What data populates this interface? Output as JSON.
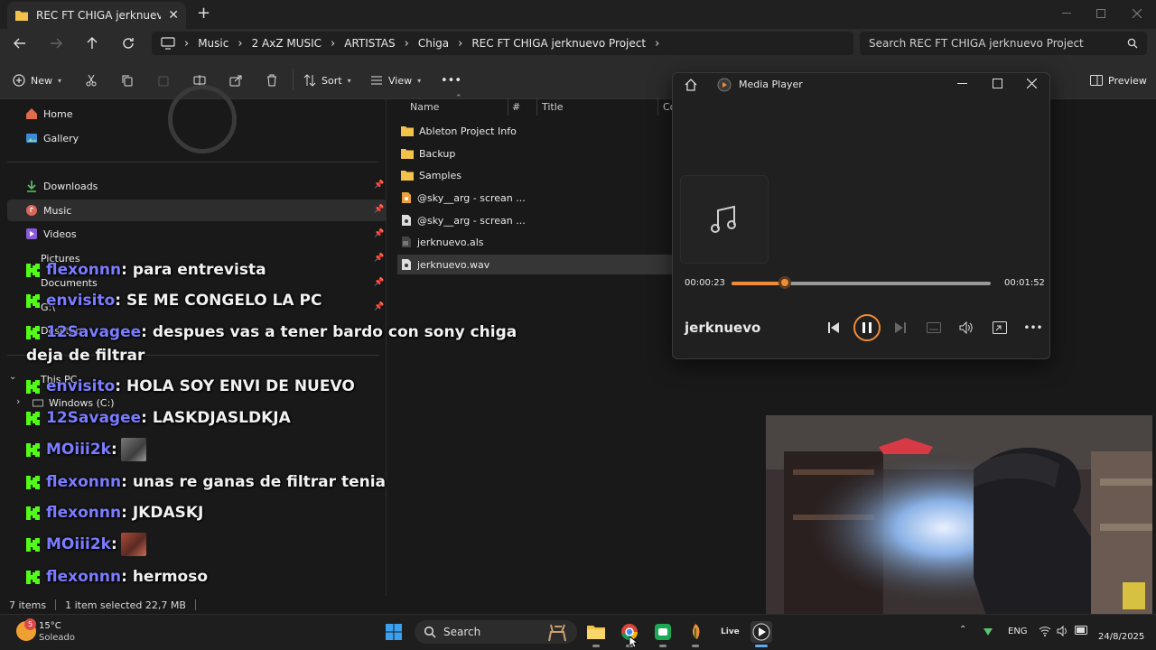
{
  "window": {
    "tab_title": "REC FT CHIGA jerknuevo Proje",
    "new_tab": "+"
  },
  "breadcrumb": [
    "Music",
    "2 AxZ MUSIC",
    "ARTISTAS",
    "Chiga",
    "REC FT CHIGA jerknuevo Project"
  ],
  "search": {
    "placeholder": "Search REC FT CHIGA jerknuevo Project"
  },
  "commands": {
    "new": "New",
    "sort": "Sort",
    "view": "View",
    "more": "•••",
    "preview": "Preview"
  },
  "nav": {
    "home": "Home",
    "gallery": "Gallery",
    "downloads": "Downloads",
    "music": "Music",
    "videos": "Videos",
    "pictures": "Pictures",
    "documents": "Documents",
    "g_drive": "G:\\",
    "desktop": "Desktop",
    "this_pc": "This PC",
    "windows_c": "Windows (C:)"
  },
  "columns": {
    "name": "Name",
    "num": "#",
    "title": "Title",
    "contrib": "Co"
  },
  "files": [
    {
      "name": "Ableton Project Info",
      "type": "folder"
    },
    {
      "name": "Backup",
      "type": "folder"
    },
    {
      "name": "Samples",
      "type": "folder"
    },
    {
      "name": "@sky__arg - screan ...",
      "type": "audio"
    },
    {
      "name": "@sky__arg - screan ...",
      "type": "file"
    },
    {
      "name": "jerknuevo.als",
      "type": "als"
    },
    {
      "name": "jerknuevo.wav",
      "type": "wav"
    }
  ],
  "status": {
    "items": "7 items",
    "selected": "1 item selected  22,7 MB"
  },
  "chat": [
    {
      "user": "flexonnn",
      "text": "para entrevista"
    },
    {
      "user": "envisito",
      "text": "SE ME CONGELO LA PC"
    },
    {
      "user": "12Savagee",
      "text": "despues vas a tener bardo con sony chiga",
      "cont": "deja de filtrar"
    },
    {
      "user": "envisito",
      "text": "HOLA SOY ENVI DE NUEVO"
    },
    {
      "user": "12Savagee",
      "text": "LASKDJASLDKJA"
    },
    {
      "user": "MOiii2k",
      "text": ""
    },
    {
      "user": "flexonnn",
      "text": "unas re ganas de filtrar tenia"
    },
    {
      "user": "flexonnn",
      "text": "JKDASKJ"
    },
    {
      "user": "MOiii2k",
      "text": ""
    },
    {
      "user": "flexonnn",
      "text": "hermoso"
    }
  ],
  "colon": ":",
  "media_player": {
    "title": "Media Player",
    "elapsed": "00:00:23",
    "total": "00:01:52",
    "track": "jerknuevo",
    "progress": 0.205,
    "accent": "#f08c38"
  },
  "taskbar": {
    "search_label": "Search",
    "weather_temp": "15°C",
    "weather_desc": "Soleado",
    "weather_badge": "5",
    "lang": "ENG",
    "date": "24/8/2025",
    "live_label": "Live"
  }
}
